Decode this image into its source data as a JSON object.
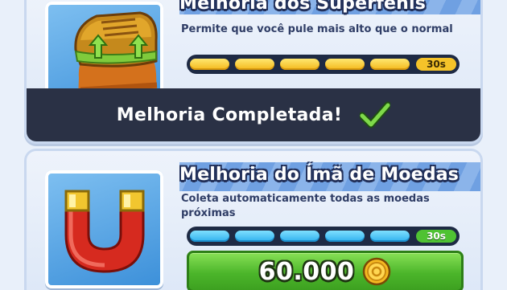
{
  "upgrades": [
    {
      "title": "Melhoria dos Superfênis",
      "description": "Permite que você pule mais alto que o normal",
      "meter_value": "30s",
      "meter_segments": 5,
      "meter_filled": 5,
      "status_label": "Melhoria Completada!",
      "icon": "super-sneakers-icon",
      "accent": "#f4b81b"
    },
    {
      "title": "Melhoria do Ímã de Moedas",
      "description": "Coleta automaticamente todas as moedas próximas",
      "meter_value": "30s",
      "meter_segments": 5,
      "meter_filled": 5,
      "price": "60.000",
      "icon": "coin-magnet-icon",
      "accent": "#2fb0ee"
    }
  ],
  "icons": {
    "check": "checkmark-icon",
    "coin": "coin-icon"
  },
  "colors": {
    "buy_green": "#4bb52a",
    "complete_bar": "#2a3145",
    "title_strip": "#8bb4ea"
  }
}
